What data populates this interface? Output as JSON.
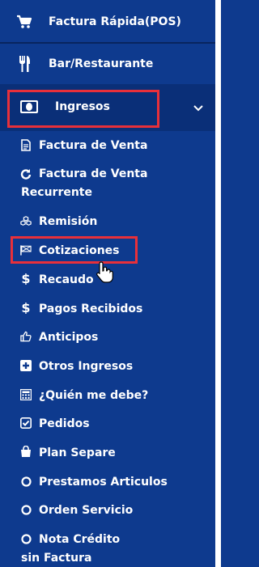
{
  "menu": {
    "top_items": [
      {
        "label": "Factura Rápida(POS)",
        "icon": "cart-icon"
      },
      {
        "label": "Bar/Restaurante",
        "icon": "fork-knife-icon"
      }
    ],
    "ingresos": {
      "label": "Ingresos",
      "icon": "money-icon",
      "expanded": true
    },
    "sub_items": [
      {
        "label": "Factura de Venta",
        "icon": "document-icon"
      },
      {
        "label": "Factura de Venta",
        "label2": "Recurrente",
        "icon": "refresh-icon"
      },
      {
        "label": "Remisión",
        "icon": "boxes-icon"
      },
      {
        "label": "Cotizaciones",
        "icon": "flag-icon"
      },
      {
        "label": "Recaudo",
        "icon": "dollar-icon"
      },
      {
        "label": "Pagos Recibidos",
        "icon": "dollar-icon"
      },
      {
        "label": "Anticipos",
        "icon": "thumbs-up-icon"
      },
      {
        "label": "Otros Ingresos",
        "icon": "plus-square-icon"
      },
      {
        "label": "¿Quién me debe?",
        "icon": "calculator-icon"
      },
      {
        "label": "Pedidos",
        "icon": "check-square-icon"
      },
      {
        "label": "Plan Separe",
        "icon": "shopping-bag-icon"
      },
      {
        "label": "Prestamos Articulos",
        "icon": "circle-icon"
      },
      {
        "label": "Orden Servicio",
        "icon": "circle-icon"
      },
      {
        "label": "Nota Crédito",
        "label2": "sin Factura",
        "icon": "circle-icon"
      }
    ]
  },
  "colors": {
    "sidebar_bg": "#0e3a8e",
    "active_bg": "#0a2f78",
    "highlight": "#e8303a",
    "text": "#ffffff"
  }
}
